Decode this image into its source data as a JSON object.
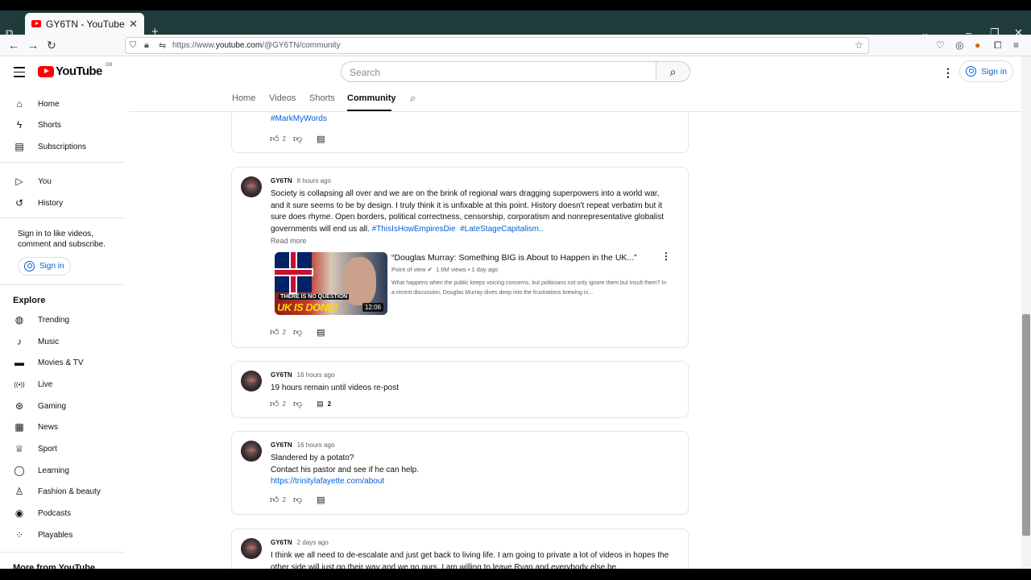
{
  "browser": {
    "tab_title": "GY6TN - YouTube",
    "url_prefix": "https://www.",
    "url_domain": "youtube.com",
    "url_path": "/@GY6TN/community"
  },
  "masthead": {
    "logo_text": "YouTube",
    "logo_region": "GB",
    "search_placeholder": "Search",
    "signin_label": "Sign in"
  },
  "sidebar": {
    "main": [
      {
        "label": "Home",
        "icon": "⌂"
      },
      {
        "label": "Shorts",
        "icon": "ϟ"
      },
      {
        "label": "Subscriptions",
        "icon": "▤"
      }
    ],
    "you": [
      {
        "label": "You",
        "icon": "▷"
      },
      {
        "label": "History",
        "icon": "↺"
      }
    ],
    "signin_prompt": "Sign in to like videos, comment and subscribe.",
    "signin_label": "Sign in",
    "explore_title": "Explore",
    "explore": [
      {
        "label": "Trending",
        "icon": "◍"
      },
      {
        "label": "Music",
        "icon": "♪"
      },
      {
        "label": "Movies & TV",
        "icon": "▬"
      },
      {
        "label": "Live",
        "icon": "((•))"
      },
      {
        "label": "Gaming",
        "icon": "⊛"
      },
      {
        "label": "News",
        "icon": "▦"
      },
      {
        "label": "Sport",
        "icon": "♕"
      },
      {
        "label": "Learning",
        "icon": "◯"
      },
      {
        "label": "Fashion & beauty",
        "icon": "♙"
      },
      {
        "label": "Podcasts",
        "icon": "◉"
      },
      {
        "label": "Playables",
        "icon": "⁘"
      }
    ],
    "more_title": "More from YouTube"
  },
  "channel_tabs": [
    "Home",
    "Videos",
    "Shorts",
    "Community"
  ],
  "posts": [
    {
      "hashtag": "#MarkMyWords",
      "likes": "2"
    },
    {
      "author": "GY6TN",
      "time": "8 hours ago",
      "text": "Society is collapsing all over and we are on the brink of regional wars dragging superpowers into a world war, and it sure seems to be by design. I truly think it is unfixable at this point. History doesn't repeat verbatim but it sure does rhyme. Open borders, political correctness, censorship, corporatism and nonrepresentative globalist governments will end us all. ",
      "tag1": "#ThisIsHowEmpiresDie",
      "tag2": "#LateStageCapitalism",
      "read_more": "Read more",
      "likes": "2",
      "video": {
        "title": "“Douglas Murray: Something BIG is About to Happen in the UK...”",
        "channel": "Point of view",
        "views": "1.6M views",
        "age": "1 day ago",
        "description": "What happens when the public keeps voicing concerns, but politicians not only ignore them but insult them? In a recent discussion, Douglas Murray dives deep into the frustrations brewing in...",
        "duration": "12:06",
        "thumb_caption1": "THERE IS NO QUESTION",
        "thumb_caption2": "UK IS DONE!"
      }
    },
    {
      "author": "GY6TN",
      "time": "16 hours ago",
      "text": "19 hours remain until videos re-post",
      "likes": "2",
      "comments": "2"
    },
    {
      "author": "GY6TN",
      "time": "16 hours ago",
      "line1": "Slandered by a potato?",
      "line2": "Contact his pastor and see if he can help.",
      "link": "https://trinitylafayette.com/about",
      "likes": "2"
    },
    {
      "author": "GY6TN",
      "time": "2 days ago",
      "text": "I think we all need to de-escalate and just get back to living life. I am going to private a lot of videos in hopes the other side will just go their way and we go ours. I am willing to leave Ryan and everybody else be."
    }
  ]
}
